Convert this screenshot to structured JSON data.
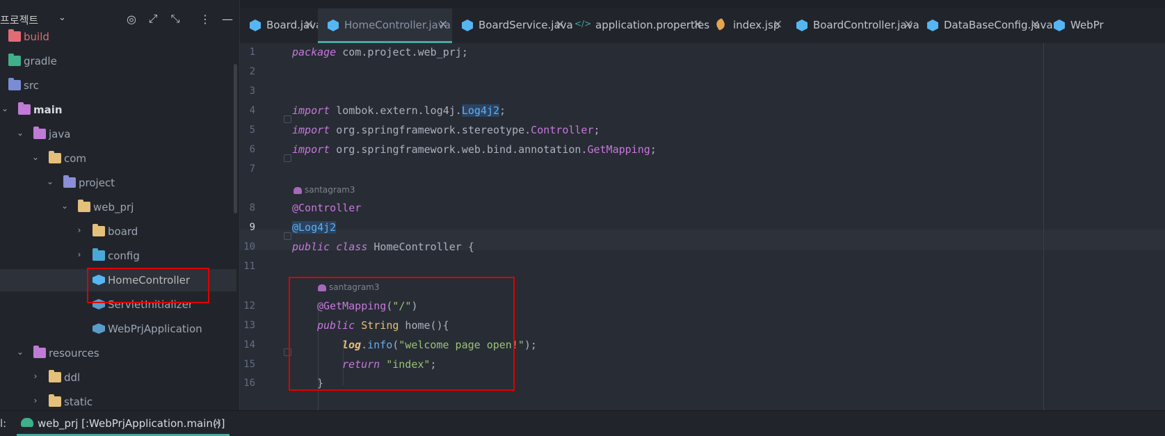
{
  "sidebar": {
    "title": "프로젝트",
    "tree": [
      {
        "label": "build",
        "style": "red",
        "icon": "folder-excluded-icon"
      },
      {
        "label": "gradle",
        "style": "dim",
        "icon": "folder-gradle-icon"
      },
      {
        "label": "src",
        "style": "dim",
        "icon": "folder-source-icon"
      },
      {
        "label": "main",
        "style": "bold",
        "icon": "folder-main-icon"
      },
      {
        "label": "java",
        "style": "dim",
        "icon": "folder-java-icon"
      },
      {
        "label": "com",
        "style": "dim",
        "icon": "folder-icon"
      },
      {
        "label": "project",
        "style": "dim",
        "icon": "folder-package-icon"
      },
      {
        "label": "web_prj",
        "style": "dim",
        "icon": "folder-icon"
      },
      {
        "label": "board",
        "style": "dim",
        "icon": "folder-icon"
      },
      {
        "label": "config",
        "style": "dim",
        "icon": "folder-config-icon"
      },
      {
        "label": "HomeController",
        "style": "normal",
        "icon": "java-class-icon"
      },
      {
        "label": "ServletInitializer",
        "style": "dim",
        "icon": "java-class-icon"
      },
      {
        "label": "WebPrjApplication",
        "style": "dim",
        "icon": "java-app-icon"
      },
      {
        "label": "resources",
        "style": "dim",
        "icon": "folder-resources-icon"
      },
      {
        "label": "ddl",
        "style": "dim",
        "icon": "folder-icon"
      },
      {
        "label": "static",
        "style": "dim",
        "icon": "folder-icon"
      }
    ]
  },
  "tabs": [
    {
      "label": "Board.java",
      "icon": "java-class-icon",
      "active": false
    },
    {
      "label": "HomeController.java",
      "icon": "java-class-icon",
      "active": true
    },
    {
      "label": "BoardService.java",
      "icon": "java-class-icon",
      "active": false
    },
    {
      "label": "application.properties",
      "icon": "properties-icon",
      "active": false
    },
    {
      "label": "index.jsp",
      "icon": "jsp-icon",
      "active": false
    },
    {
      "label": "BoardController.java",
      "icon": "java-class-icon",
      "active": false
    },
    {
      "label": "DataBaseConfig.java",
      "icon": "java-class-icon",
      "active": false
    },
    {
      "label": "WebPr",
      "icon": "java-app-icon",
      "active": false
    }
  ],
  "tab_close_glyph": "×",
  "editor": {
    "line_numbers": [
      "1",
      "2",
      "3",
      "4",
      "5",
      "6",
      "7",
      "8",
      "9",
      "10",
      "11",
      "12",
      "13",
      "14",
      "15",
      "16"
    ],
    "current_line": "9",
    "author": "santagram3",
    "code": {
      "l1_kw": "package",
      "l1_rest": " com.project.web_prj;",
      "imp": "import",
      "l4_pkg": " lombok.extern.log4j.",
      "l4_cls": "Log4j2",
      "l4_end": ";",
      "l5_pkg": " org.springframework.stereotype.",
      "l5_cls": "Controller",
      "l5_end": ";",
      "l6_pkg": " org.springframework.web.bind.annotation.",
      "l6_cls": "GetMapping",
      "l6_end": ";",
      "l8": "@Controller",
      "l9": "@Log4j2",
      "l10_kw": "public class",
      "l10_rest": " HomeController {",
      "l12_ann": "@GetMapping",
      "l12_open": "(",
      "l12_str": "\"/\"",
      "l12_close": ")",
      "l13_kw": "public",
      "l13_type": " String",
      "l13_rest": " home(){",
      "l14_var": "log",
      "l14_dot": ".",
      "l14_fn": "info",
      "l14_open": "(",
      "l14_str": "\"welcome page open!\"",
      "l14_close": ");",
      "l15_kw": "return",
      "l15_str": " \"index\"",
      "l15_end": ";",
      "l16": "}"
    }
  },
  "run_bar": {
    "label": "l:",
    "tab_label": "web_prj [:WebPrjApplication.main()]",
    "close": "×"
  },
  "colors": {
    "accent": "#4aa8a0",
    "highlight_box": "#e00000",
    "keyword": "#c678dd",
    "string": "#98c379"
  }
}
